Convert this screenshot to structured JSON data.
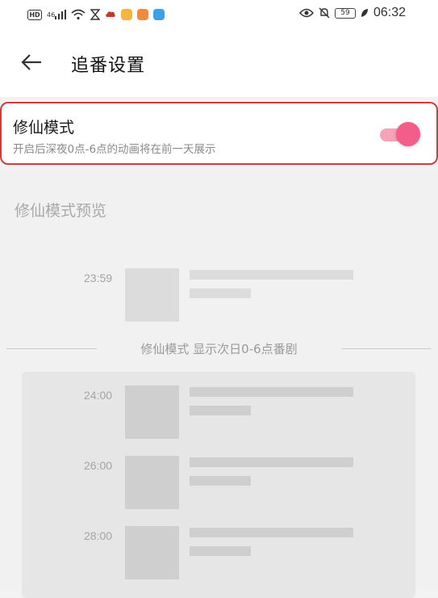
{
  "status_bar": {
    "hd": "HD",
    "signal": "46",
    "battery": "59",
    "time": "06:32"
  },
  "header": {
    "title": "追番设置"
  },
  "setting": {
    "title": "修仙模式",
    "subtitle": "开启后深夜0点-6点的动画将在前一天展示",
    "enabled": true,
    "accent_color": "#f25d8a"
  },
  "preview": {
    "title": "修仙模式预览",
    "before_rows": [
      {
        "time": "23:59"
      }
    ],
    "divider_text": "修仙模式 显示次日0-6点番剧",
    "after_rows": [
      {
        "time": "24:00"
      },
      {
        "time": "26:00"
      },
      {
        "time": "28:00"
      }
    ]
  }
}
